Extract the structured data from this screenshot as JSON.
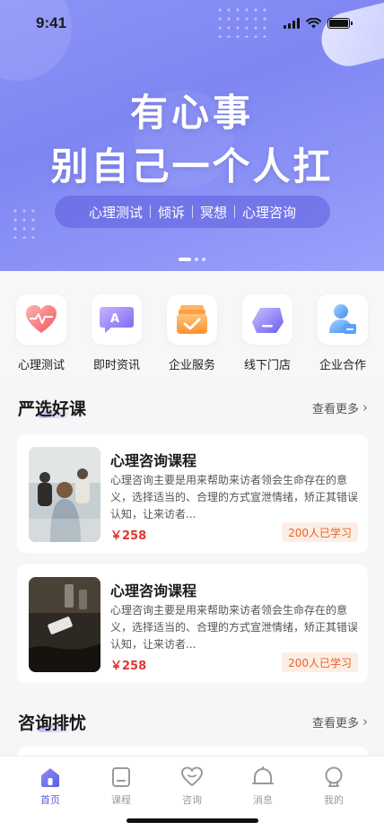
{
  "status_bar": {
    "time": "9:41"
  },
  "hero": {
    "line1": "有心事",
    "line2": "别自己一个人扛",
    "tags": [
      "心理测试",
      "倾诉",
      "冥想",
      "心理咨询"
    ]
  },
  "categories": [
    {
      "label": "心理测试",
      "icon": "heart-pulse-icon"
    },
    {
      "label": "即时资讯",
      "icon": "chat-bubble-icon"
    },
    {
      "label": "企业服务",
      "icon": "folder-check-icon"
    },
    {
      "label": "线下门店",
      "icon": "store-icon"
    },
    {
      "label": "企业合作",
      "icon": "partner-icon"
    }
  ],
  "featured": {
    "title": "严选好课",
    "see_more": "查看更多",
    "courses": [
      {
        "title": "心理咨询课程",
        "desc": "心理咨询主要是用来帮助来访者领会生命存在的意义，选择适当的、合理的方式宣泄情绪，矫正其错误认知，让来访者...",
        "price": "￥258",
        "learners": "200人已学习"
      },
      {
        "title": "心理咨询课程",
        "desc": "心理咨询主要是用来帮助来访者领会生命存在的意义，选择适当的、合理的方式宣泄情绪，矫正其错误认知，让来访者...",
        "price": "￥258",
        "learners": "200人已学习"
      }
    ]
  },
  "consult": {
    "title": "咨询排忧",
    "see_more": "查看更多"
  },
  "tabbar": [
    {
      "label": "首页",
      "icon": "home-icon",
      "active": true
    },
    {
      "label": "课程",
      "icon": "course-icon",
      "active": false
    },
    {
      "label": "咨询",
      "icon": "consult-heart-icon",
      "active": false
    },
    {
      "label": "消息",
      "icon": "bell-icon",
      "active": false
    },
    {
      "label": "我的",
      "icon": "profile-icon",
      "active": false
    }
  ],
  "colors": {
    "accent": "#5b5fe0",
    "hero": "#8b93f6",
    "price": "#e4352c",
    "badge": "#e8622a"
  }
}
